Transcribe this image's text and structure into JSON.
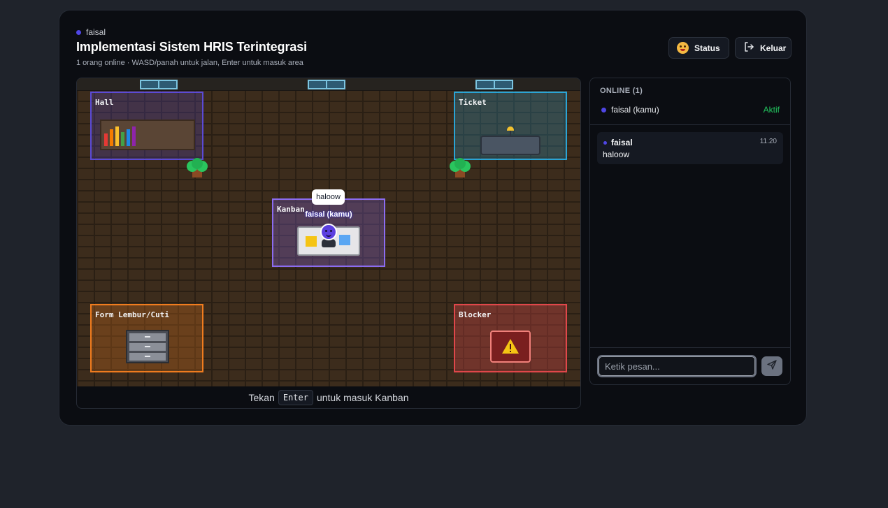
{
  "header": {
    "username": "faisal",
    "title": "Implementasi Sistem HRIS Terintegrasi",
    "subtitle": "1 orang online · WASD/panah untuk jalan, Enter untuk masuk area",
    "status_label": "Status",
    "logout_label": "Keluar"
  },
  "map": {
    "zones": {
      "hall": "Hall",
      "ticket": "Ticket",
      "kanban": "Kanban",
      "form": "Form Lembur/Cuti",
      "blocker": "Blocker"
    },
    "player": {
      "name": "faisal (kamu)",
      "bubble": "haloow"
    },
    "footer": {
      "prefix": "Tekan",
      "key": "Enter",
      "suffix": "untuk masuk Kanban"
    }
  },
  "sidebar": {
    "online_header": "ONLINE (1)",
    "users": [
      {
        "name": "faisal (kamu)",
        "status": "Aktif"
      }
    ],
    "messages": [
      {
        "author": "faisal",
        "time": "11.20",
        "text": "haloow"
      }
    ],
    "input_placeholder": "Ketik pesan..."
  },
  "colors": {
    "accent": "#4f46e5",
    "online": "#22c55e",
    "hall": "#5b4ad6",
    "ticket": "#2aa4d5",
    "kanban": "#8b6cf0",
    "form": "#f07c1e",
    "blocker": "#e0474a"
  },
  "icons": {
    "status": "emoji-face-icon",
    "logout": "logout-icon",
    "send": "send-icon",
    "warning": "warning-icon"
  }
}
